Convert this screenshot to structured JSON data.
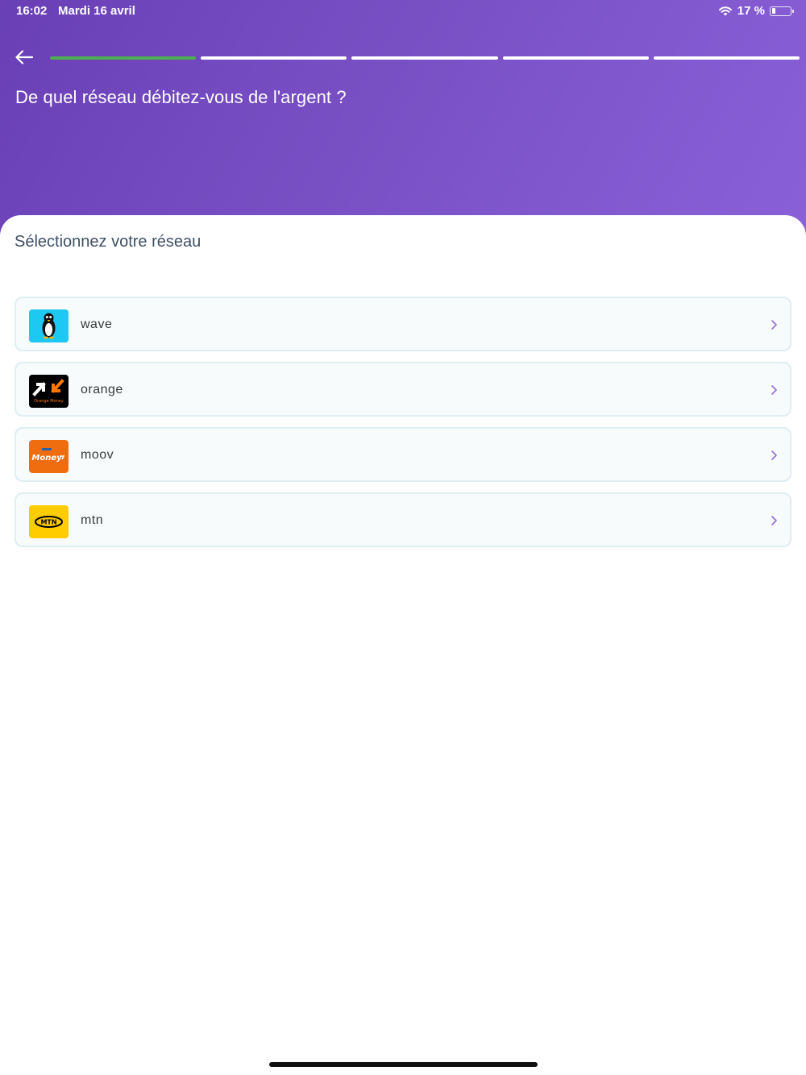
{
  "status_bar": {
    "time": "16:02",
    "date": "Mardi 16 avril",
    "battery_percent": "17 %",
    "battery_level": 0.17,
    "icons": [
      "wifi-icon",
      "battery-icon"
    ]
  },
  "header": {
    "back_icon": "arrow-left-icon",
    "question": "De quel réseau débitez-vous de l'argent ?",
    "progress": {
      "total_steps": 5,
      "completed_steps": 1,
      "completed_color": "#4caf50",
      "pending_color": "#ffffff"
    },
    "gradient_colors": [
      "#6a3fb6",
      "#8a60d8"
    ]
  },
  "sheet": {
    "title": "Sélectionnez votre réseau",
    "networks": [
      {
        "label": "wave",
        "logo": "wave-penguin-logo",
        "logo_bg": "#1dc8f2"
      },
      {
        "label": "orange",
        "logo": "orange-money-logo",
        "logo_bg": "#000000",
        "logo_text": "Orange Money"
      },
      {
        "label": "moov",
        "logo": "moov-money-logo",
        "logo_bg": "#ef6c0f",
        "logo_text": "Money"
      },
      {
        "label": "mtn",
        "logo": "mtn-logo",
        "logo_bg": "#ffcc00",
        "logo_text": "MTN"
      }
    ],
    "chevron_color": "#9b6ad6"
  }
}
